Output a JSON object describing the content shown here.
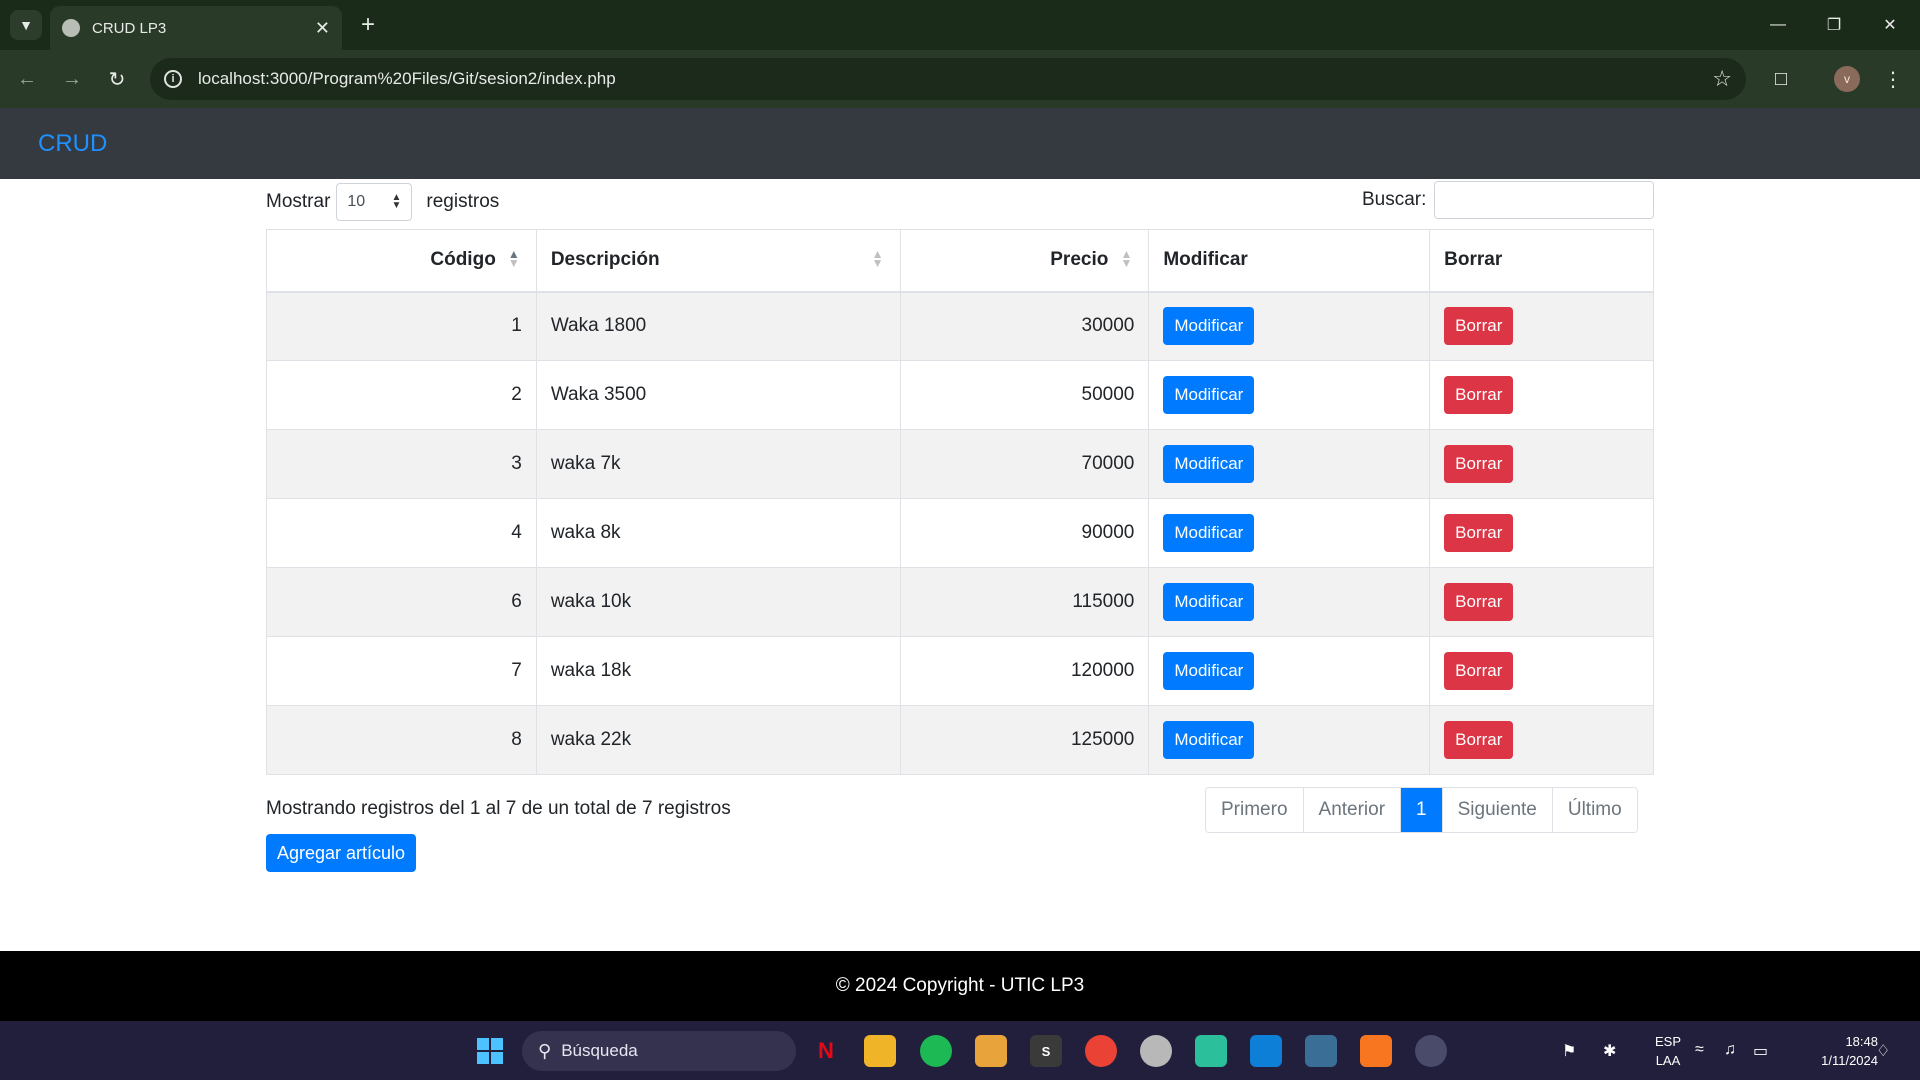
{
  "browser": {
    "tab_title": "CRUD LP3",
    "url": "localhost:3000/Program%20Files/Git/sesion2/index.php",
    "profile_initial": "v"
  },
  "navbar": {
    "brand": "CRUD"
  },
  "table_controls": {
    "show_label": "Mostrar",
    "page_length": "10",
    "records_label": "registros",
    "search_label": "Buscar:",
    "search_value": ""
  },
  "table": {
    "headers": {
      "codigo": "Código",
      "descripcion": "Descripción",
      "precio": "Precio",
      "modificar": "Modificar",
      "borrar": "Borrar"
    },
    "rows": [
      {
        "codigo": "1",
        "descripcion": "Waka 1800",
        "precio": "30000",
        "modify_label": "Modificar",
        "delete_label": "Borrar"
      },
      {
        "codigo": "2",
        "descripcion": "Waka 3500",
        "precio": "50000",
        "modify_label": "Modificar",
        "delete_label": "Borrar"
      },
      {
        "codigo": "3",
        "descripcion": "waka 7k",
        "precio": "70000",
        "modify_label": "Modificar",
        "delete_label": "Borrar"
      },
      {
        "codigo": "4",
        "descripcion": "waka 8k",
        "precio": "90000",
        "modify_label": "Modificar",
        "delete_label": "Borrar"
      },
      {
        "codigo": "6",
        "descripcion": "waka 10k",
        "precio": "115000",
        "modify_label": "Modificar",
        "delete_label": "Borrar"
      },
      {
        "codigo": "7",
        "descripcion": "waka 18k",
        "precio": "120000",
        "modify_label": "Modificar",
        "delete_label": "Borrar"
      },
      {
        "codigo": "8",
        "descripcion": "waka 22k",
        "precio": "125000",
        "modify_label": "Modificar",
        "delete_label": "Borrar"
      }
    ]
  },
  "info": "Mostrando registros del 1 al 7 de un total de 7 registros",
  "pagination": {
    "first": "Primero",
    "previous": "Anterior",
    "current": "1",
    "next": "Siguiente",
    "last": "Último"
  },
  "add_button": "Agregar artículo",
  "footer": "© 2024 Copyright - UTIC LP3",
  "taskbar": {
    "search_placeholder": "Búsqueda",
    "language_top": "ESP",
    "language_bottom": "LAA",
    "time": "18:48",
    "date": "1/11/2024"
  },
  "colors": {
    "primary": "#007bff",
    "danger": "#dc3545",
    "navbar": "#343a40",
    "brand": "#1e90ff"
  }
}
